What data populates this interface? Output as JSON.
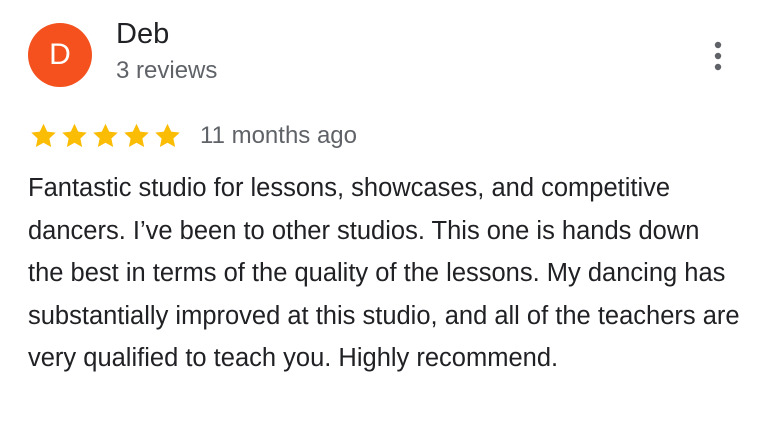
{
  "review": {
    "reviewer": {
      "initial": "D",
      "name": "Deb",
      "review_count": "3 reviews",
      "avatar_color": "#F4511E"
    },
    "more_icon": "more-vert-icon",
    "rating": {
      "stars": 5,
      "max_stars": 5,
      "star_color": "#FBBC04"
    },
    "date": "11 months ago",
    "text": "Fantastic studio for lessons, showcases, and competitive dancers. I’ve been to other studios. This one is hands down the best in terms of the quality of the lessons. My dancing has substantially improved at this studio, and all of the teachers are very qualified to teach you. Highly recommend."
  }
}
